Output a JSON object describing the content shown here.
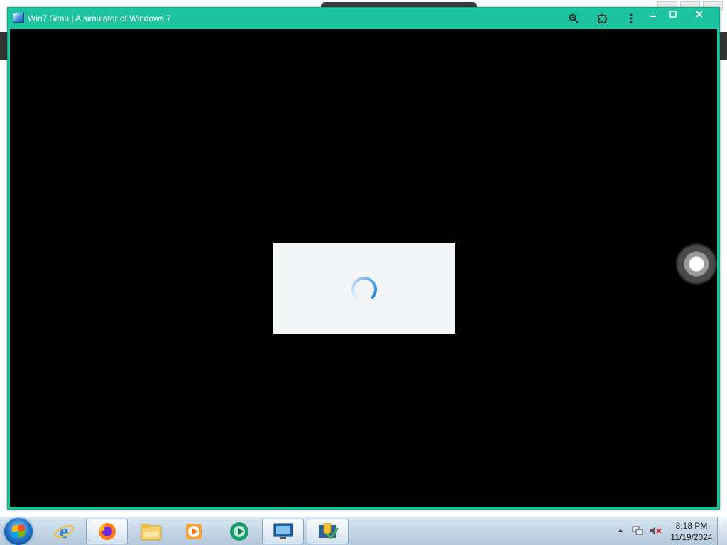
{
  "window": {
    "title": "Win7 Simu | A simulator of Windows 7",
    "accent_color": "#1ec3a0",
    "toolbar_icons": [
      "zoom-icon",
      "extension-icon",
      "more-options-icon"
    ],
    "controls": [
      "minimize",
      "maximize",
      "close"
    ]
  },
  "content": {
    "background": "#000000",
    "loading_state": "spinner"
  },
  "taskbar": {
    "pinned": [
      "internet-explorer-icon",
      "firefox-icon",
      "windows-explorer-icon",
      "media-player-icon",
      "green-app-icon",
      "display-settings-icon",
      "security-center-icon"
    ],
    "active_item": "firefox-icon",
    "tray_icons": [
      "show-hidden-icons-arrow",
      "network-icon",
      "volume-muted-icon"
    ],
    "clock": {
      "time": "8:18 PM",
      "date": "11/19/2024"
    }
  }
}
